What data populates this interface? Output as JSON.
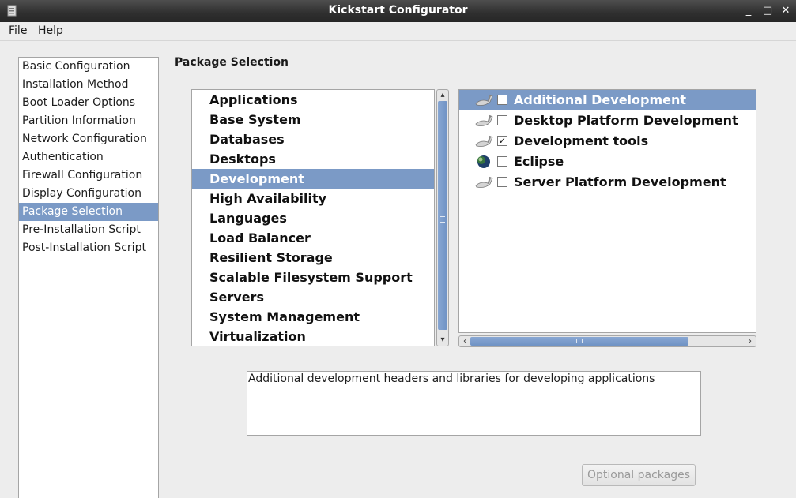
{
  "window": {
    "title": "Kickstart Configurator",
    "controls": {
      "minimize": "_",
      "maximize": "□",
      "close": "✕"
    }
  },
  "menu": {
    "file": "File",
    "help": "Help"
  },
  "nav": {
    "items": [
      {
        "label": "Basic Configuration",
        "selected": false
      },
      {
        "label": "Installation Method",
        "selected": false
      },
      {
        "label": "Boot Loader Options",
        "selected": false
      },
      {
        "label": "Partition Information",
        "selected": false
      },
      {
        "label": "Network Configuration",
        "selected": false
      },
      {
        "label": "Authentication",
        "selected": false
      },
      {
        "label": "Firewall Configuration",
        "selected": false
      },
      {
        "label": "Display Configuration",
        "selected": false
      },
      {
        "label": "Package Selection",
        "selected": true
      },
      {
        "label": "Pre-Installation Script",
        "selected": false
      },
      {
        "label": "Post-Installation Script",
        "selected": false
      }
    ]
  },
  "section": {
    "title": "Package Selection"
  },
  "groups": {
    "items": [
      {
        "label": "Applications",
        "selected": false
      },
      {
        "label": "Base System",
        "selected": false
      },
      {
        "label": "Databases",
        "selected": false
      },
      {
        "label": "Desktops",
        "selected": false
      },
      {
        "label": "Development",
        "selected": true
      },
      {
        "label": "High Availability",
        "selected": false
      },
      {
        "label": "Languages",
        "selected": false
      },
      {
        "label": "Load Balancer",
        "selected": false
      },
      {
        "label": "Resilient Storage",
        "selected": false
      },
      {
        "label": "Scalable Filesystem Support",
        "selected": false
      },
      {
        "label": "Servers",
        "selected": false
      },
      {
        "label": "System Management",
        "selected": false
      },
      {
        "label": "Virtualization",
        "selected": false
      }
    ]
  },
  "packages": {
    "items": [
      {
        "label": "Additional Development",
        "checked": false,
        "selected": true,
        "icon": "tools-icon"
      },
      {
        "label": "Desktop Platform Development",
        "checked": false,
        "selected": false,
        "icon": "tools-icon"
      },
      {
        "label": "Development tools",
        "checked": true,
        "selected": false,
        "icon": "tools-icon"
      },
      {
        "label": "Eclipse",
        "checked": false,
        "selected": false,
        "icon": "eclipse-icon"
      },
      {
        "label": "Server Platform Development",
        "checked": false,
        "selected": false,
        "icon": "tools-icon"
      }
    ]
  },
  "description": {
    "text": "Additional development headers and libraries for developing applications"
  },
  "optional_button": {
    "label": "Optional packages",
    "enabled": false
  },
  "colors": {
    "selection": "#7b9ac6",
    "titlebar": "#3a3a3a",
    "background": "#ededed"
  }
}
